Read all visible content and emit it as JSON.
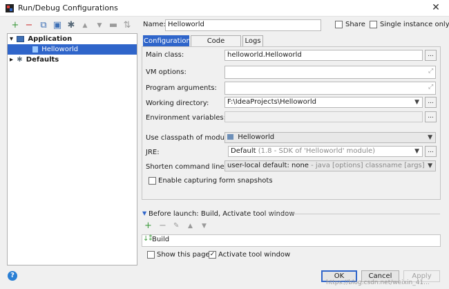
{
  "window": {
    "title": "Run/Debug Configurations",
    "close_glyph": "✕"
  },
  "toolbar": {
    "icons": [
      {
        "name": "add-icon",
        "glyph": "+"
      },
      {
        "name": "remove-icon",
        "glyph": "−"
      },
      {
        "name": "copy-icon",
        "glyph": "⧉"
      },
      {
        "name": "save-icon",
        "glyph": "▣"
      },
      {
        "name": "wrench-icon",
        "glyph": "✱"
      },
      {
        "name": "move-up-icon",
        "glyph": "▲"
      },
      {
        "name": "move-down-icon",
        "glyph": "▼"
      },
      {
        "name": "folder-icon",
        "glyph": "▬"
      },
      {
        "name": "sort-icon",
        "glyph": "⇅"
      }
    ]
  },
  "tree": {
    "application": {
      "label": "Application",
      "arrow": "▾"
    },
    "helloworld": {
      "label": "Helloworld"
    },
    "defaults": {
      "label": "Defaults",
      "arrow": "▸"
    }
  },
  "header": {
    "name_label": "Name:",
    "name_value": "Helloworld",
    "share_label": "Share",
    "single_instance_label": "Single instance only"
  },
  "tabs": [
    {
      "label": "Configuration"
    },
    {
      "label": "Code Coverage"
    },
    {
      "label": "Logs"
    }
  ],
  "form": {
    "main_class": {
      "label": "Main class:",
      "value": "helloworld.Helloworld"
    },
    "vm_options": {
      "label": "VM options:",
      "value": ""
    },
    "program_arguments": {
      "label": "Program arguments:",
      "value": ""
    },
    "working_directory": {
      "label": "Working directory:",
      "value": "F:\\IdeaProjects\\Helloworld"
    },
    "environment_variables": {
      "label": "Environment variables:",
      "value": ""
    },
    "classpath_module": {
      "label": "Use classpath of module:",
      "value": "Helloworld"
    },
    "jre": {
      "label": "JRE:",
      "value": "Default",
      "hint": "(1.8 - SDK of 'Helloworld' module)"
    },
    "shorten_command_line": {
      "label": "Shorten command line:",
      "value": "user-local default: none",
      "hint": "- java [options] classname [args]"
    },
    "capture_snapshots": {
      "label": "Enable capturing form snapshots"
    },
    "dots": "..."
  },
  "before_launch": {
    "title": "Before launch: Build, Activate tool window",
    "task": "Build",
    "show_page_label": "Show this page",
    "activate_label": "Activate tool window"
  },
  "buttons": {
    "ok": "OK",
    "cancel": "Cancel",
    "apply": "Apply"
  },
  "help_glyph": "?",
  "watermark": "https://blog.csdn.net/weixin_41..."
}
